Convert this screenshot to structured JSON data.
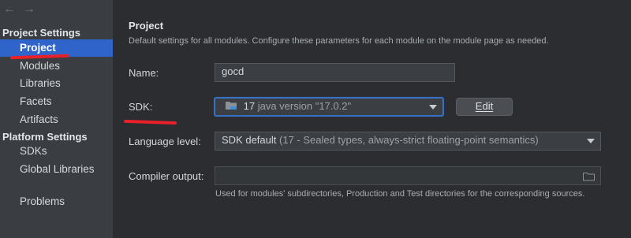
{
  "nav": {
    "back_icon": "←",
    "forward_icon": "→"
  },
  "sidebar": {
    "project_settings_header": "Project Settings",
    "project_items": [
      {
        "label": "Project"
      },
      {
        "label": "Modules"
      },
      {
        "label": "Libraries"
      },
      {
        "label": "Facets"
      },
      {
        "label": "Artifacts"
      }
    ],
    "platform_settings_header": "Platform Settings",
    "platform_items": [
      {
        "label": "SDKs"
      },
      {
        "label": "Global Libraries"
      }
    ],
    "problems_label": "Problems",
    "selected": "Project"
  },
  "main": {
    "title": "Project",
    "description": "Default settings for all modules. Configure these parameters for each module on the module page as needed.",
    "name_label": "Name:",
    "name_value": "gocd",
    "sdk_label": "SDK:",
    "sdk_version": "17",
    "sdk_detail": "java version \"17.0.2\"",
    "edit_button": "Edit",
    "language_label": "Language level:",
    "language_value": "SDK default",
    "language_detail": "(17 - Sealed types, always-strict floating-point semantics)",
    "compiler_label": "Compiler output:",
    "compiler_value": "",
    "compiler_hint": "Used for modules' subdirectories, Production and Test directories for the corresponding sources."
  },
  "colors": {
    "selection": "#2f65ca",
    "annotation_red": "#e8202a",
    "focus_border": "#3572c8"
  }
}
